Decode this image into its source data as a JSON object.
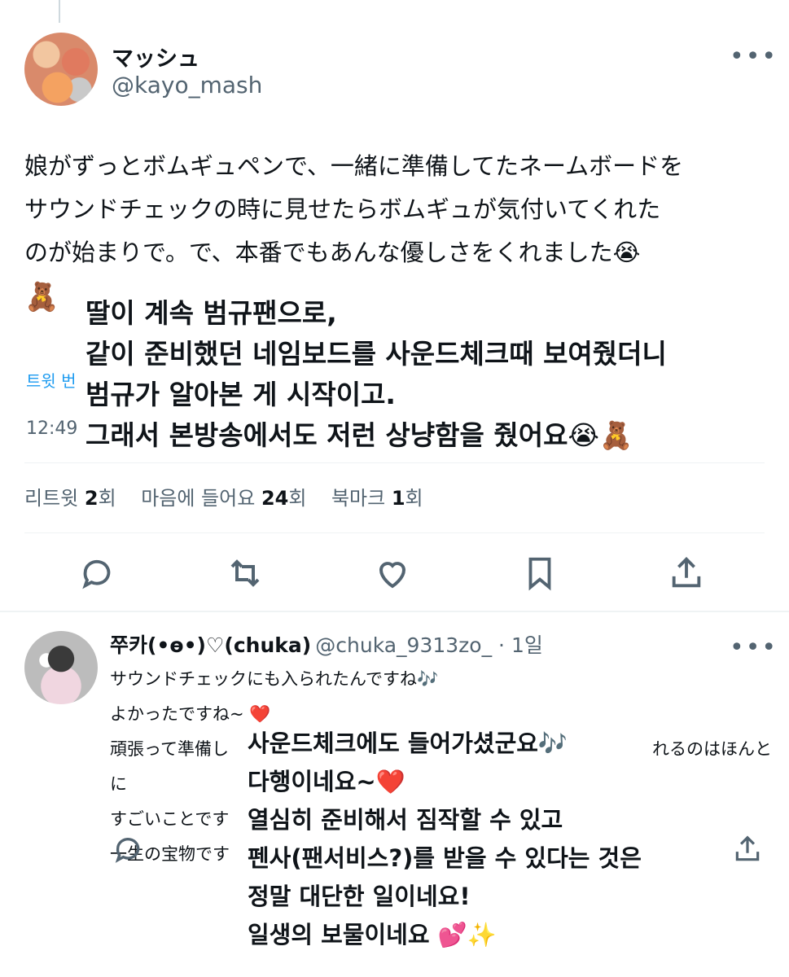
{
  "tweet": {
    "author_name": "マッシュ",
    "author_handle": "@kayo_mash",
    "more_icon": "more-dots-icon",
    "text_lines": [
      "娘がずっとボムギュペンで、一緒に準備してたネームボードを",
      "サウンドチェックの時に見せたらボムギュが気付いてくれた",
      "のが始まりで。で、本番でもあんな優しさをくれました😭"
    ],
    "bear_emoji": "🧸",
    "translate_link": "트윗 번",
    "time_fragment": "12:49",
    "korean_overlay_lines": [
      "딸이 계속 범규팬으로,",
      "같이 준비했던 네임보드를 사운드체크때 보여줬더니",
      "범규가 알아본 게 시작이고.",
      "그래서 본방송에서도 저런 상냥함을 줬어요😭🧸"
    ],
    "stats": {
      "retweet_label": "리트윗 ",
      "retweet_count": "2",
      "retweet_unit": "회",
      "like_label": "마음에 들어요 ",
      "like_count": "24",
      "like_unit": "회",
      "bookmark_label": "북마크 ",
      "bookmark_count": "1",
      "bookmark_unit": "회"
    },
    "actions": [
      "reply-icon",
      "retweet-icon",
      "like-icon",
      "bookmark-icon",
      "share-icon"
    ]
  },
  "reply": {
    "author_name": "쭈카(•ө•)♡(chuka)",
    "author_handle": "@chuka_9313zo_ · 1일",
    "text_lines": [
      "サウンドチェックにも入られたんですね🎶",
      "よかったですね~ ❤️",
      "頑張って準備し",
      "すごいことです",
      "一生の宝物です"
    ],
    "line3_tail": "れるのはほんとに",
    "korean_overlay_lines": [
      "사운드체크에도 들어가셨군요🎶",
      "다행이네요~❤️",
      "열심히 준비해서 짐작할 수 있고",
      "펜사(팬서비스?)를 받을 수 있다는 것은",
      "정말 대단한 일이네요!",
      "일생의 보물이네요 💕✨"
    ]
  }
}
